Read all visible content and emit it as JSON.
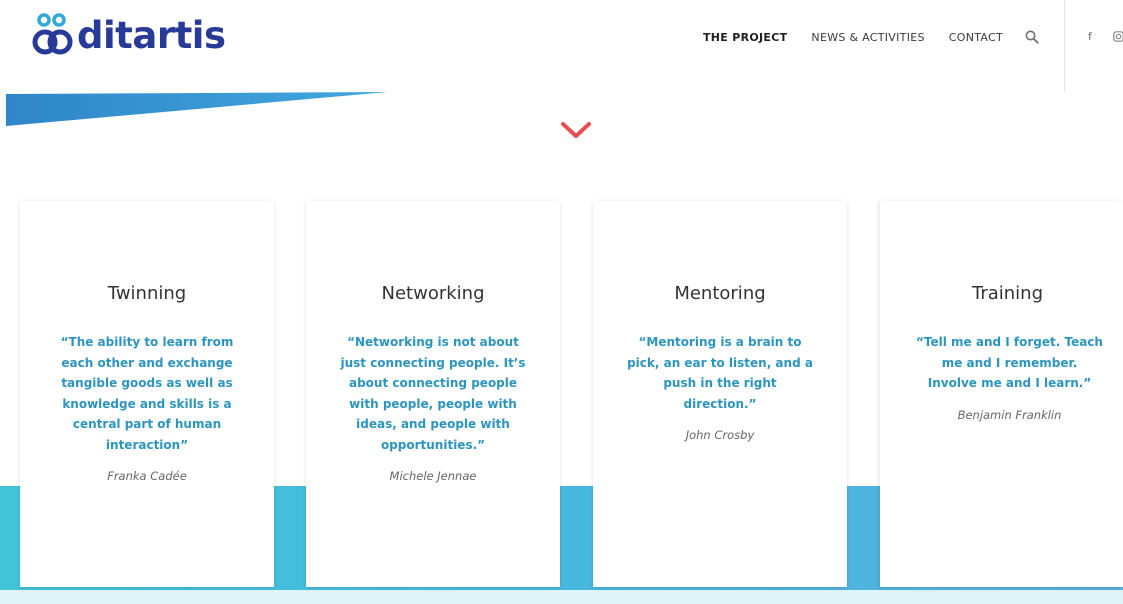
{
  "brand": {
    "name": "ditartis"
  },
  "nav": {
    "items": [
      {
        "label": "THE PROJECT"
      },
      {
        "label": "NEWS & ACTIVITIES"
      },
      {
        "label": "CONTACT"
      }
    ],
    "social": {
      "facebook": "f"
    }
  },
  "colors": {
    "brand_blue": "#283a97",
    "accent_red": "#e84f4f",
    "quote_blue": "#2c95be",
    "band_cyan": "#41c3d8"
  },
  "cards": [
    {
      "title": "Twinning",
      "quote": "“The ability to learn from each other and exchange tangible goods as well as knowledge and skills is a central part of human interaction”",
      "author": "Franka Cadée"
    },
    {
      "title": "Networking",
      "quote": "“Networking is not about just connecting people. It’s about connecting people with people, people with ideas, and people with opportunities.”",
      "author": "Michele Jennae"
    },
    {
      "title": "Mentoring",
      "quote": "“Mentoring is a brain to pick, an ear to listen, and a push in the right direction.”",
      "author": "John Crosby"
    },
    {
      "title": "Training",
      "quote": "“Tell me and I forget. Teach me and I remember. Involve me and I learn.”",
      "author": "Benjamin Franklin"
    }
  ]
}
